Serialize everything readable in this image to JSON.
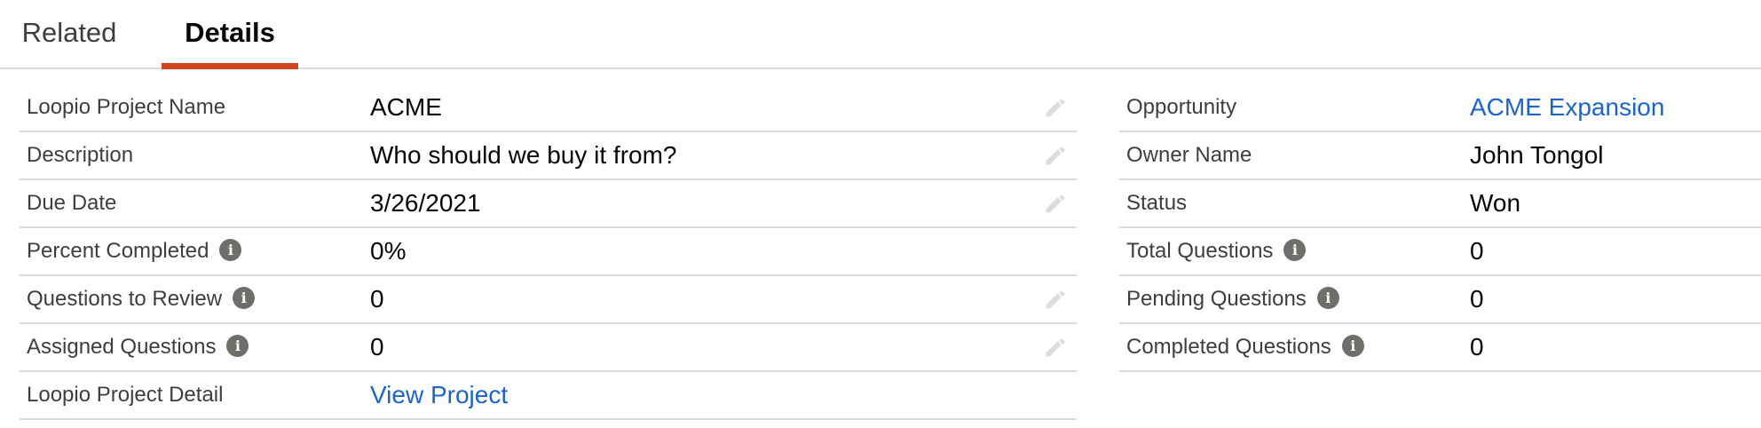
{
  "tabs": [
    {
      "label": "Related",
      "active": false
    },
    {
      "label": "Details",
      "active": true
    }
  ],
  "left_fields": [
    {
      "label": "Loopio Project Name",
      "value": "ACME"
    },
    {
      "label": "Description",
      "value": "Who should we buy it from?"
    },
    {
      "label": "Due Date",
      "value": "3/26/2021"
    },
    {
      "label": "Percent Completed",
      "value": "0%"
    },
    {
      "label": "Questions to Review",
      "value": "0"
    },
    {
      "label": "Assigned Questions",
      "value": "0"
    },
    {
      "label": "Loopio Project Detail",
      "value": "View Project"
    }
  ],
  "right_fields": [
    {
      "label": "Opportunity",
      "value": "ACME Expansion"
    },
    {
      "label": "Owner Name",
      "value": "John Tongol"
    },
    {
      "label": "Status",
      "value": "Won"
    },
    {
      "label": "Total Questions",
      "value": "0"
    },
    {
      "label": "Pending Questions",
      "value": "0"
    },
    {
      "label": "Completed Questions",
      "value": "0"
    }
  ],
  "icons": {
    "info": "info-icon",
    "edit": "pencil-icon"
  },
  "colors": {
    "active_tab_underline": "#d24522",
    "link": "#1b64c8",
    "label": "#3e3e3c",
    "divider": "#dddbda"
  }
}
